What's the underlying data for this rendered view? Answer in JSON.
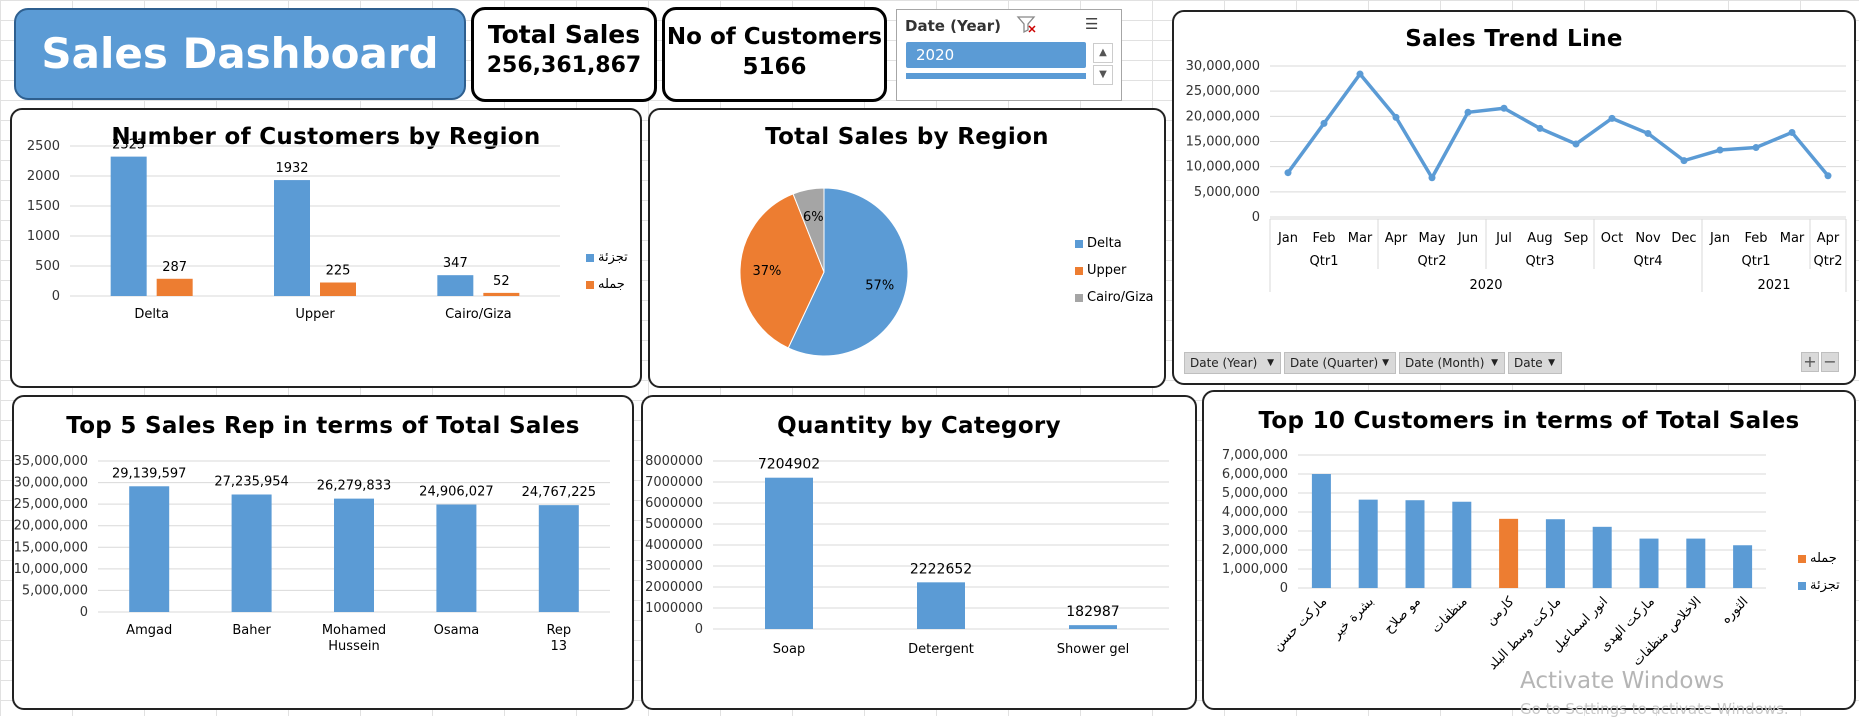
{
  "header": {
    "title": "Sales Dashboard"
  },
  "kpis": {
    "total_sales_label": "Total Sales",
    "total_sales_value": "256,361,867",
    "customers_label": "No of Customers",
    "customers_value": "5166"
  },
  "slicer": {
    "title": "Date (Year)",
    "selected": "2020"
  },
  "colors": {
    "blue": "#5b9bd5",
    "orange": "#ed7d31",
    "gray": "#a5a5a5",
    "header": "#5b9bd5"
  },
  "panels": {
    "customers_region": "Number of Customers by Region",
    "sales_region": "Total Sales by Region",
    "trend": "Sales Trend Line",
    "sales_rep": "Top 5 Sales Rep in terms of Total Sales",
    "category": "Quantity by Category",
    "top_customers": "Top 10 Customers in terms of Total Sales"
  },
  "field_buttons": [
    "Date (Year)",
    "Date (Quarter)",
    "Date (Month)",
    "Date"
  ],
  "watermark": {
    "line1": "Activate Windows",
    "line2": "Go to Settings to activate Windows."
  },
  "chart_data": [
    {
      "id": "customers_region",
      "type": "bar",
      "title": "Number of Customers by Region",
      "categories": [
        "Delta",
        "Upper",
        "Cairo/Giza"
      ],
      "series": [
        {
          "name": "تجزئة",
          "values": [
            2323,
            1932,
            347
          ],
          "color": "#5b9bd5"
        },
        {
          "name": "جمله",
          "values": [
            287,
            225,
            52
          ],
          "color": "#ed7d31"
        }
      ],
      "ylim": [
        0,
        2500
      ],
      "yticks": [
        "0",
        "500",
        "1000",
        "1500",
        "2000",
        "2500"
      ],
      "grid": true,
      "legend": "right"
    },
    {
      "id": "sales_region",
      "type": "pie",
      "title": "Total Sales by Region",
      "labels": [
        "Delta",
        "Upper",
        "Cairo/Giza"
      ],
      "values": [
        57,
        37,
        6
      ],
      "value_labels": [
        "57%",
        "37%",
        "6%"
      ],
      "colors": [
        "#5b9bd5",
        "#ed7d31",
        "#a5a5a5"
      ],
      "legend": "right"
    },
    {
      "id": "trend",
      "type": "line",
      "title": "Sales Trend Line",
      "months": [
        "Jan",
        "Feb",
        "Mar",
        "Apr",
        "May",
        "Jun",
        "Jul",
        "Aug",
        "Sep",
        "Oct",
        "Nov",
        "Dec",
        "Jan",
        "Feb",
        "Mar",
        "Apr"
      ],
      "quarters": [
        {
          "label": "Qtr1",
          "span": 3
        },
        {
          "label": "Qtr2",
          "span": 3
        },
        {
          "label": "Qtr3",
          "span": 3
        },
        {
          "label": "Qtr4",
          "span": 3
        },
        {
          "label": "Qtr1",
          "span": 3
        },
        {
          "label": "Qtr2",
          "span": 1
        }
      ],
      "years": [
        {
          "label": "2020",
          "span": 12
        },
        {
          "label": "2021",
          "span": 4
        }
      ],
      "values": [
        8800000,
        18600000,
        28400000,
        19800000,
        7800000,
        20800000,
        21600000,
        17600000,
        14500000,
        19600000,
        16600000,
        11200000,
        13300000,
        13800000,
        16800000,
        8200000
      ],
      "ylim": [
        0,
        30000000
      ],
      "yticks": [
        "0",
        "5,000,000",
        "10,000,000",
        "15,000,000",
        "20,000,000",
        "25,000,000",
        "30,000,000"
      ],
      "color": "#5b9bd5",
      "grid": true
    },
    {
      "id": "sales_rep",
      "type": "bar",
      "title": "Top 5 Sales Rep in terms of Total Sales",
      "categories": [
        "Amgad",
        "Baher",
        "Mohamed Hussein",
        "Osama",
        "Rep 13"
      ],
      "values": [
        29139597,
        27235954,
        26279833,
        24906027,
        24767225
      ],
      "value_labels": [
        "29,139,597",
        "27,235,954",
        "26,279,833",
        "24,906,027",
        "24,767,225"
      ],
      "ylim": [
        0,
        35000000
      ],
      "yticks": [
        "0",
        "5,000,000",
        "10,000,000",
        "15,000,000",
        "20,000,000",
        "25,000,000",
        "30,000,000",
        "35,000,000"
      ],
      "color": "#5b9bd5",
      "grid": true
    },
    {
      "id": "category",
      "type": "bar",
      "title": "Quantity by Category",
      "categories": [
        "Soap",
        "Detergent",
        "Shower gel"
      ],
      "values": [
        7204902,
        2222652,
        182987
      ],
      "value_labels": [
        "7204902",
        "2222652",
        "182987"
      ],
      "ylim": [
        0,
        8000000
      ],
      "yticks": [
        "0",
        "1000000",
        "2000000",
        "3000000",
        "4000000",
        "5000000",
        "6000000",
        "7000000",
        "8000000"
      ],
      "color": "#5b9bd5",
      "grid": true
    },
    {
      "id": "top_customers",
      "type": "bar",
      "title": "Top 10 Customers in terms of Total Sales",
      "categories": [
        "ماركت حسن",
        "بشرة خير",
        "مو صلاح",
        "منظفات",
        "كارمن",
        "ماركت وسط البلد",
        "انور اسماعيل",
        "ماركت الهدى",
        "الاخلاص منظفات",
        "الثوره"
      ],
      "values": [
        6000000,
        4650000,
        4620000,
        4540000,
        3640000,
        3620000,
        3220000,
        2600000,
        2600000,
        2250000
      ],
      "series_index": [
        0,
        0,
        0,
        0,
        1,
        0,
        0,
        0,
        0,
        0
      ],
      "series": [
        {
          "name": "تجزئة",
          "color": "#5b9bd5"
        },
        {
          "name": "جمله",
          "color": "#ed7d31"
        }
      ],
      "ylim": [
        0,
        7000000
      ],
      "yticks": [
        "0",
        "1,000,000",
        "2,000,000",
        "3,000,000",
        "4,000,000",
        "5,000,000",
        "6,000,000",
        "7,000,000"
      ],
      "grid": true,
      "legend": "right"
    }
  ]
}
